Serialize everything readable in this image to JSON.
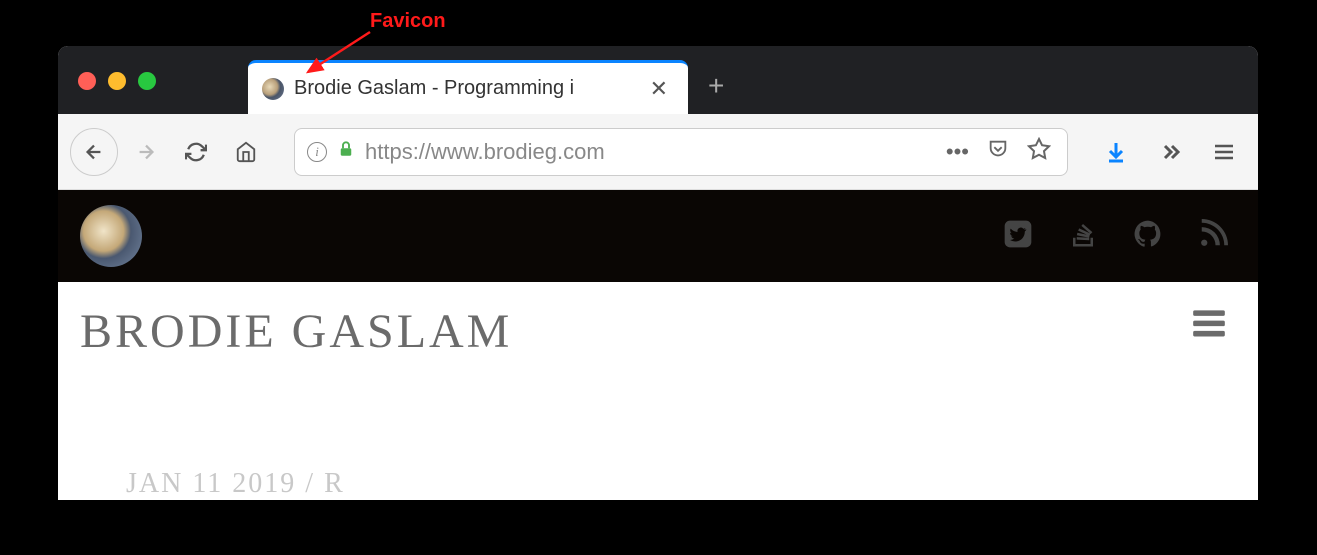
{
  "annotation": {
    "label": "Favicon"
  },
  "browser": {
    "tab": {
      "title": "Brodie Gaslam - Programming i",
      "favicon": "moon"
    },
    "url": "https://www.brodieg.com",
    "icons": {
      "info": "info-icon",
      "lock": "lock-icon",
      "dots": "more-icon",
      "pocket": "pocket-icon",
      "star": "bookmark-icon",
      "download": "download-icon",
      "overflow": "overflow-icon",
      "menu": "hamburger-icon"
    }
  },
  "page": {
    "title": "BRODIE GASLAM",
    "social": {
      "twitter": "twitter-icon",
      "stackoverflow": "stackoverflow-icon",
      "github": "github-icon",
      "rss": "rss-icon"
    },
    "post_meta": "JAN 11 2019 / R"
  }
}
